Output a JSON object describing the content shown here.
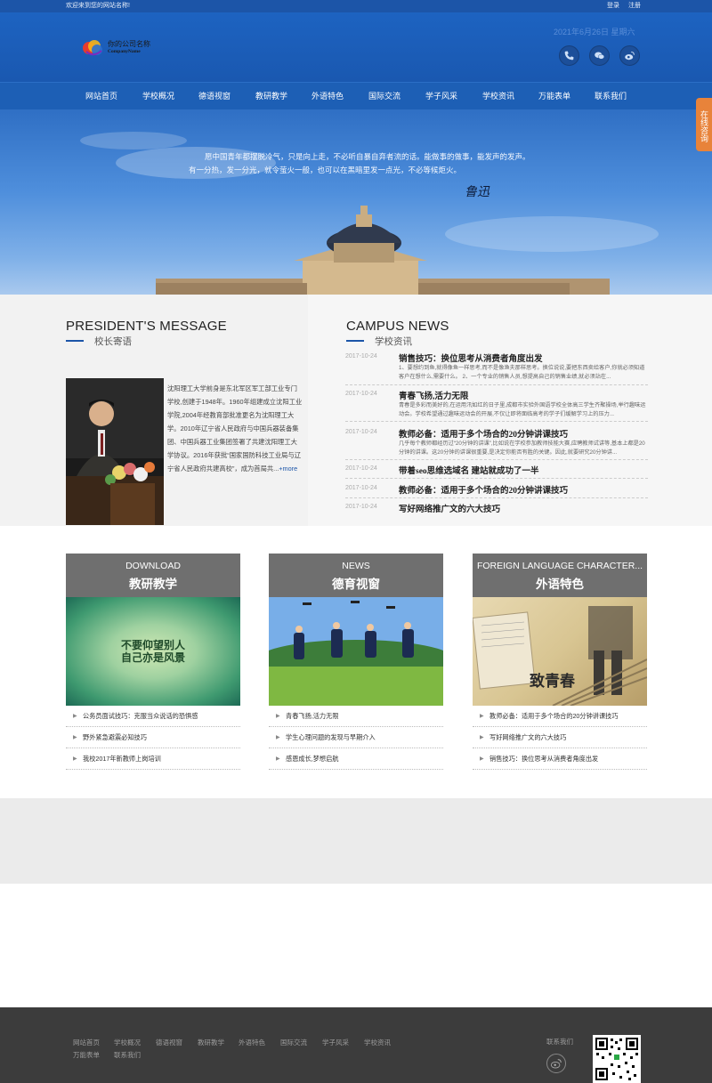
{
  "topbar": {
    "welcome": "欢迎来到您的网站名称!",
    "login": "登录",
    "register": "注册"
  },
  "header": {
    "logo_name": "你的公司名称",
    "logo_sub": "CompanyName",
    "date": "2021年6月26日    星期六",
    "social_icons": [
      "phone-icon",
      "wechat-icon",
      "weibo-icon"
    ]
  },
  "nav": {
    "items": [
      "网站首页",
      "学校概况",
      "德语视窗",
      "教研教学",
      "外语特色",
      "国际交流",
      "学子风采",
      "学校资讯",
      "万能表单",
      "联系我们"
    ]
  },
  "banner": {
    "quote_line1": "愿中国青年都摆脱冷气，只是向上走，不必听自暴自弃者流的话。能做事的做事，能发声的发声。",
    "quote_line2": "有一分热，发一分光，就令萤火一般，也可以在黑暗里发一点光，不必等候炬火。",
    "signature": "鲁迅"
  },
  "side": {
    "consult": "在线咨询",
    "top": "↑"
  },
  "president": {
    "title_en": "PRESIDENT'S MESSAGE",
    "title_cn": "校长寄语",
    "text": "沈阳理工大学前身是东北军区军工部工业专门学校,创建于1948年。1960年组建成立沈阳工业学院,2004年经教育部批准更名为沈阳理工大学。2010年辽宁省人民政府与中国兵器装备集团、中国兵器工业集团签署了共建沈阳理工大学协议。2016年获批“国家国防科技工业局与辽宁省人民政府共建高校”，成为首局共...",
    "more": "+more"
  },
  "campus_news": {
    "title_en": "CAMPUS NEWS",
    "title_cn": "学校资讯",
    "items": [
      {
        "date": "2017-10-24",
        "title": "销售技巧：换位思考从消费者角度出发",
        "desc": "1、要想约到鱼,就得像鱼一样思考,而不是像渔夫那样思考。换位说说,要把东西卖给客户,你就必须知道客户在想什么,需要什么。        2、一个专业的销售人员,想提高自己的销售业绩,就必须站在..."
      },
      {
        "date": "2017-10-24",
        "title": "青春飞扬,活力无限",
        "desc": "青春是多彩而美好的,在运用汛如红的日子里,成都市实验外国语学校全体高三学生齐聚操场,举行趣味运动会。学校希望通过趣味运动会的开展,不仅让即将面临高考的学子们缓解学习上的压力..."
      },
      {
        "date": "2017-10-24",
        "title": "教师必备：适用于多个场合的20分钟讲课技巧",
        "desc": "几乎每个教师都经历过“20分钟的讲课”,比如说在学校参加教师技能大赛,应聘教师试讲等,基本上都是20分钟的讲课。这20分钟的讲课很重要,是决定你能否有胜的关键。因此,就要研究20分钟讲..."
      },
      {
        "date": "2017-10-24",
        "title": "带着seo思维选域名 建站就成功了一半",
        "desc": ""
      },
      {
        "date": "2017-10-24",
        "title": "教师必备：适用于多个场合的20分钟讲课技巧",
        "desc": ""
      },
      {
        "date": "2017-10-24",
        "title": "写好网络推广文的六大技巧",
        "desc": ""
      }
    ]
  },
  "cards": [
    {
      "en": "DOWNLOAD",
      "cn": "教研教学",
      "img_text_1": "不要仰望别人",
      "img_text_2": "自己亦是风景",
      "links": [
        "公务员面试技巧：克服当众说话的恐惧感",
        "野外紧急避震必知技巧",
        "我校2017年新教师上岗培训"
      ]
    },
    {
      "en": "NEWS",
      "cn": "德育视窗",
      "links": [
        "青春飞扬,活力无限",
        "学生心理问题的发现与早期介入",
        "感恩成长,梦想启航"
      ]
    },
    {
      "en": "FOREIGN LANGUAGE CHARACTER...",
      "cn": "外语特色",
      "img_text_1": "致青春",
      "links": [
        "教师必备：适用于多个场合的20分钟讲课技巧",
        "写好网络推广文的六大技巧",
        "销售技巧：换位思考从消费者角度出发"
      ]
    }
  ],
  "footer": {
    "links_row1": [
      "网站首页",
      "学校概况",
      "德语视窗",
      "教研教学",
      "外语特色",
      "国际交流",
      "学子风采",
      "学校资讯"
    ],
    "links_row2": [
      "万能表单",
      "联系我们"
    ],
    "contact": "联系我们"
  },
  "colors": {
    "brand_blue": "#1c55a8",
    "consult_orange": "#e8833a",
    "footer_bg": "#3c3c3c"
  }
}
